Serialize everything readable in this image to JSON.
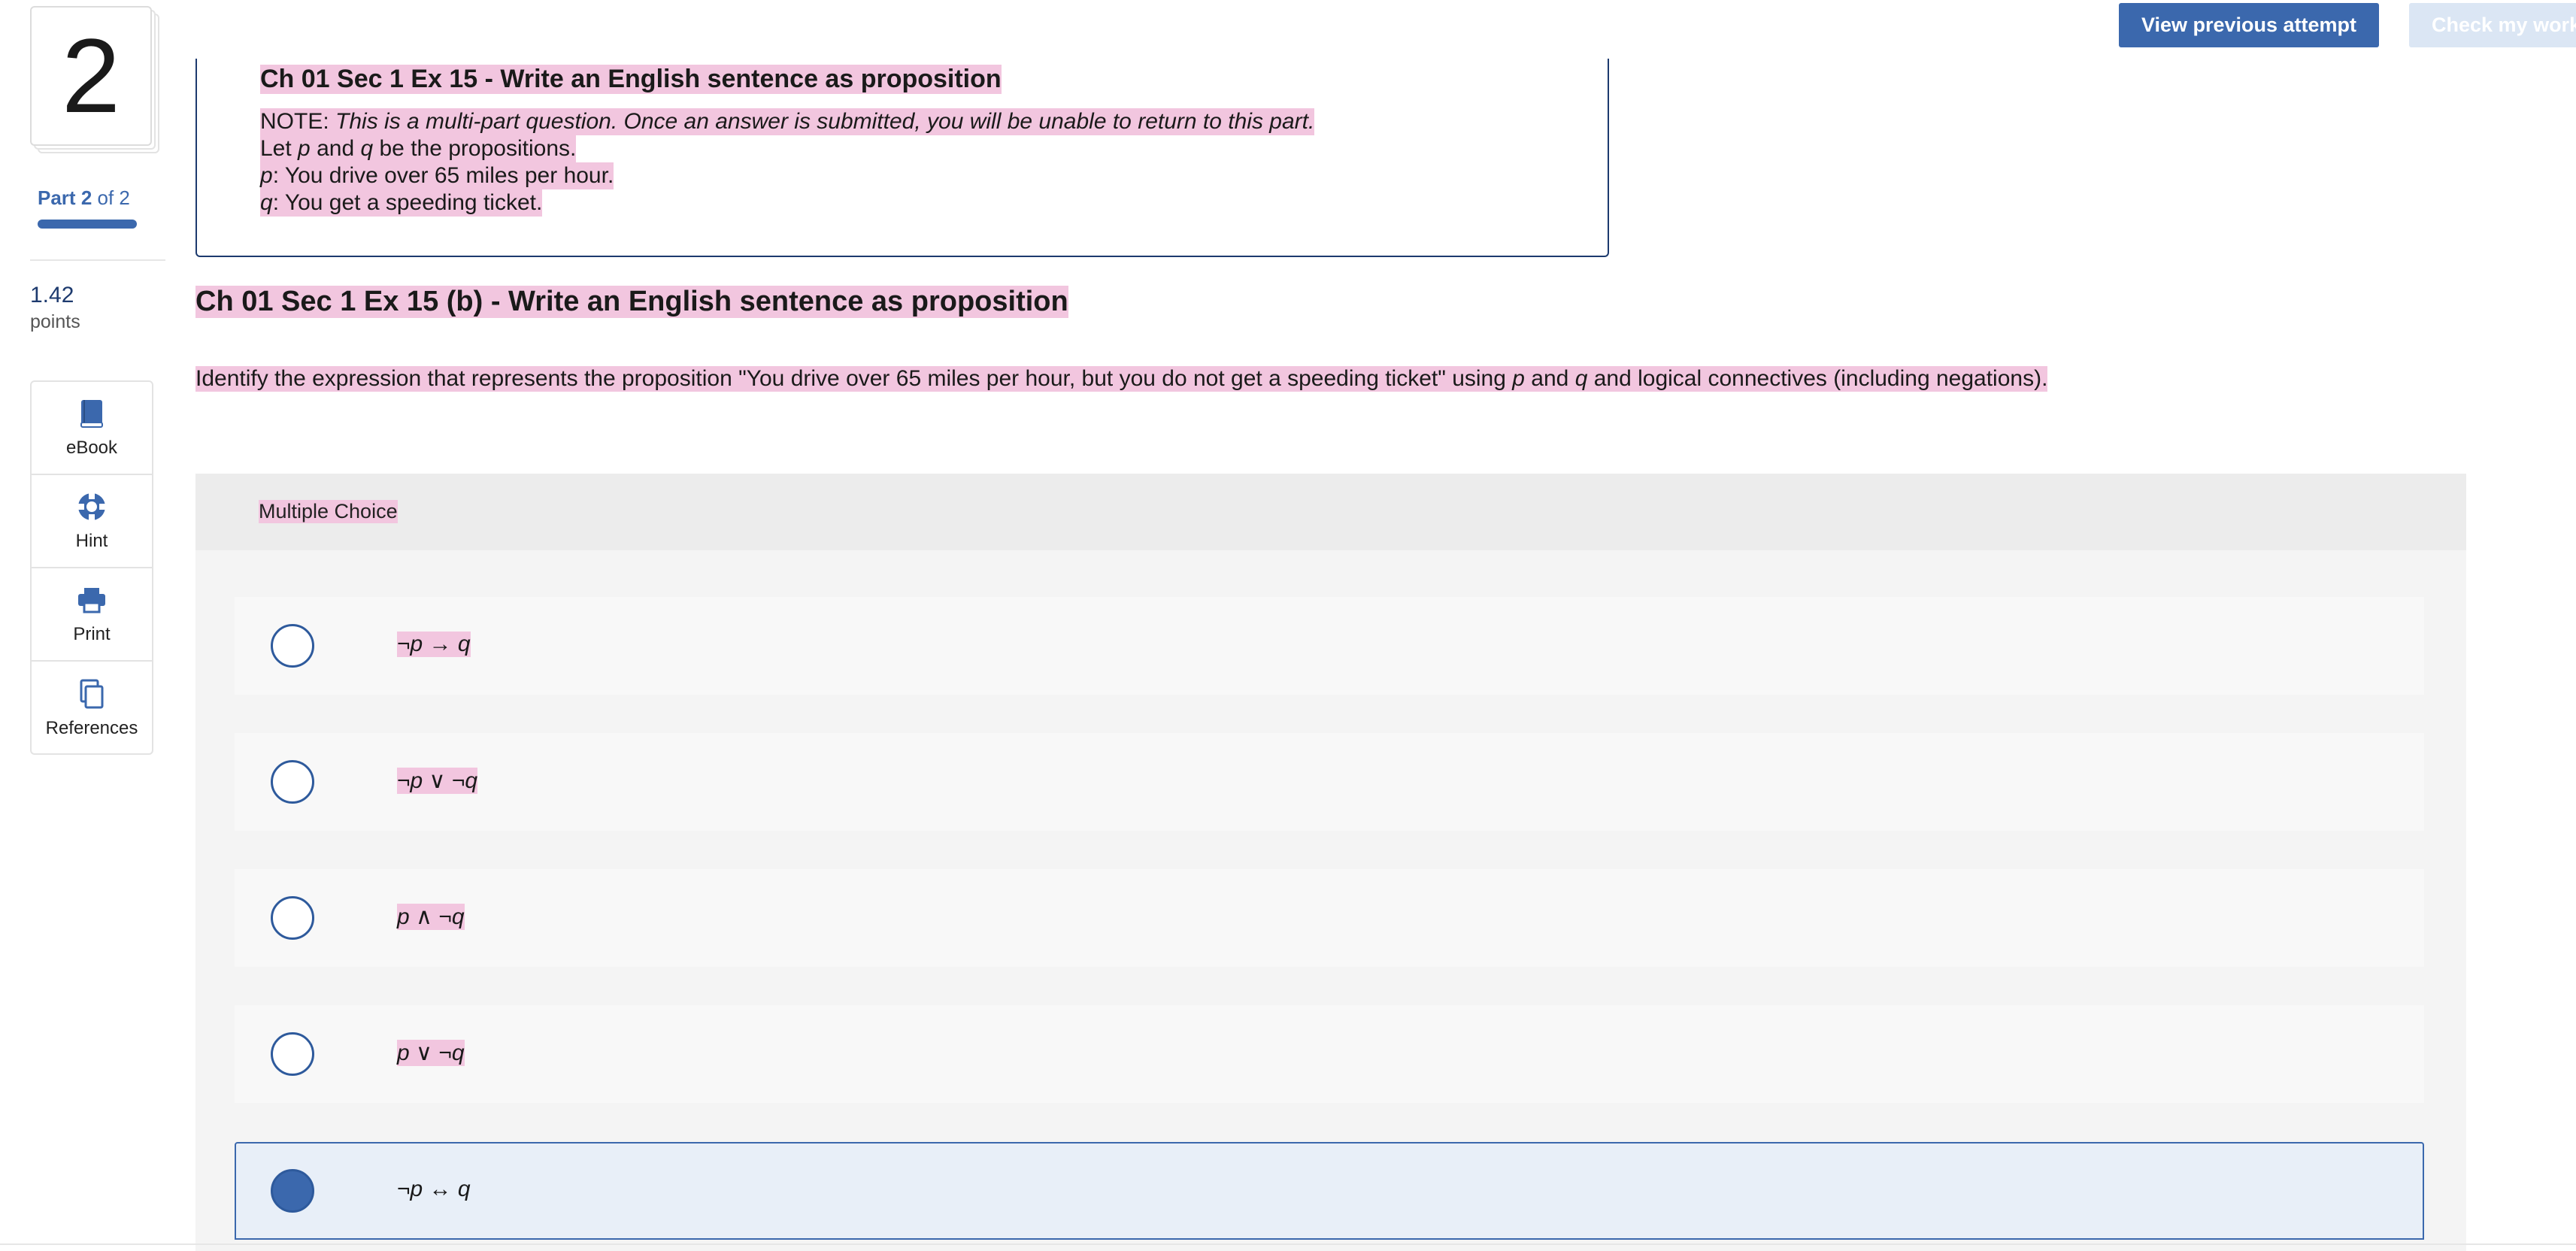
{
  "header": {
    "view_previous_label": "View previous attempt",
    "check_work_label": "Check my work"
  },
  "sidebar": {
    "question_number": "2",
    "part_prefix": "Part",
    "part_current": "2",
    "part_of": "of 2",
    "part_progress": 1.0,
    "points_value": "1.42",
    "points_label": "points",
    "tools": [
      {
        "label": "eBook",
        "icon": "book-icon"
      },
      {
        "label": "Hint",
        "icon": "lifebuoy-icon"
      },
      {
        "label": "Print",
        "icon": "printer-icon"
      },
      {
        "label": "References",
        "icon": "documents-icon"
      }
    ]
  },
  "intro": {
    "title": "Ch 01 Sec 1 Ex 15 - Write an English sentence as proposition",
    "note_prefix": "NOTE: ",
    "note_text": "This is a multi-part question. Once an answer is submitted, you will be unable to return to this part.",
    "let_text_1": "Let ",
    "let_p": "p",
    "let_text_2": " and ",
    "let_q": "q",
    "let_text_3": " be the propositions.",
    "p_var": "p",
    "p_text": ": You drive over 65 miles per hour.",
    "q_var": "q",
    "q_text": ": You get a speeding ticket."
  },
  "main": {
    "title": "Ch 01 Sec 1 Ex 15 (b) - Write an English sentence as proposition",
    "question_part1": "Identify the expression that represents the proposition \"You drive over 65 miles per hour, but you do not get a speeding ticket\" using ",
    "question_p": "p",
    "question_part2": " and ",
    "question_q": "q",
    "question_part3": " and logical connectives (including negations)."
  },
  "multiple_choice": {
    "header": "Multiple Choice",
    "options": [
      {
        "text": "¬p → q",
        "selected": false
      },
      {
        "text": "¬p ∨ ¬q",
        "selected": false
      },
      {
        "text": "p ∧ ¬q",
        "selected": false
      },
      {
        "text": "p ∨ ¬q",
        "selected": false
      },
      {
        "text": "¬p ↔ q",
        "selected": true
      }
    ]
  },
  "colors": {
    "accent": "#3b68ad",
    "highlight": "#f2c6df",
    "selected_bg": "#e8eff8"
  }
}
